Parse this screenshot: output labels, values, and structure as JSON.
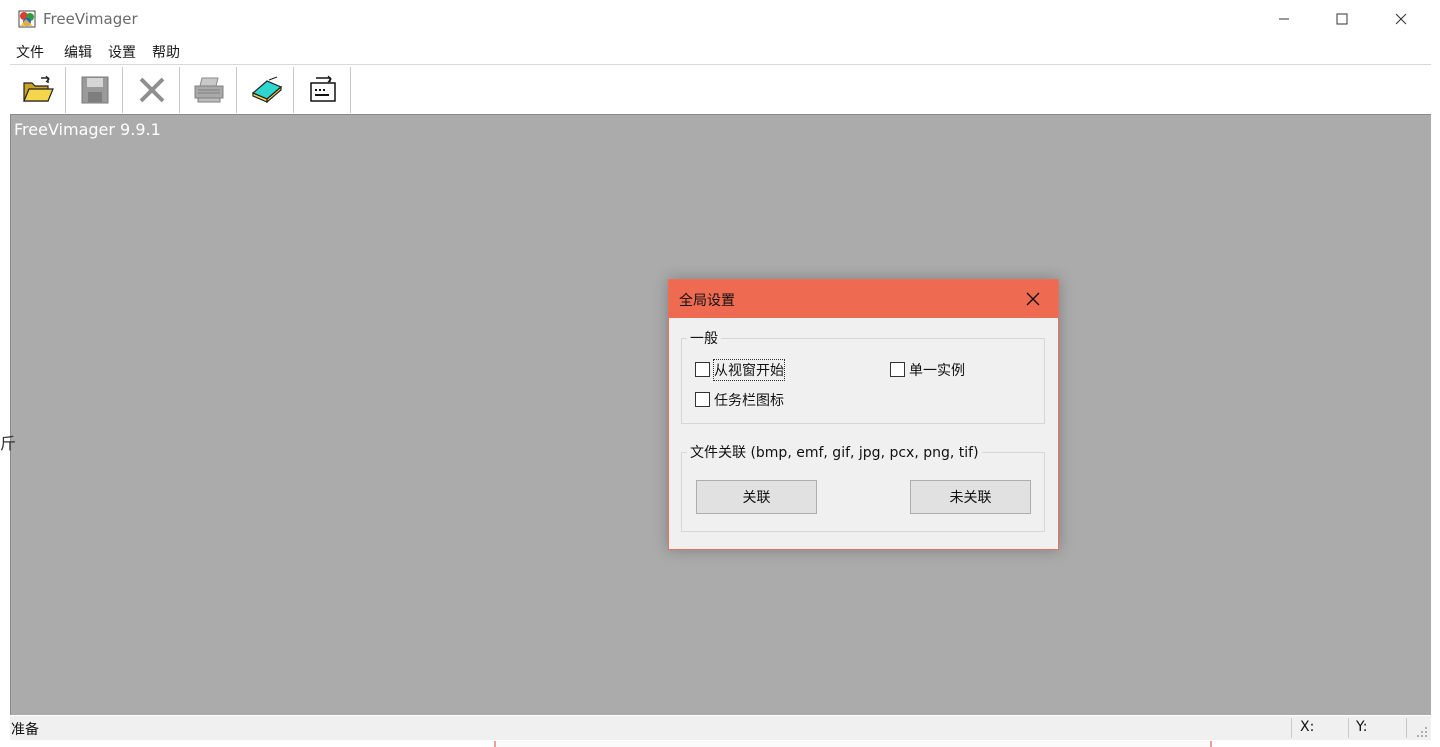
{
  "window": {
    "title": "FreeVimager",
    "controls": {
      "minimize": "—",
      "maximize": "☐",
      "close": "✕"
    }
  },
  "menubar": {
    "items": [
      {
        "label": "文件"
      },
      {
        "label": "编辑"
      },
      {
        "label": "设置"
      },
      {
        "label": "帮助"
      }
    ]
  },
  "toolbar": {
    "buttons": [
      {
        "icon": "open-folder-icon"
      },
      {
        "icon": "save-disk-icon"
      },
      {
        "icon": "close-x-icon"
      },
      {
        "icon": "printer-icon"
      },
      {
        "icon": "scanner-icon"
      },
      {
        "icon": "slideshow-icon"
      }
    ]
  },
  "workspace": {
    "version_label": "FreeVimager 9.9.1",
    "background_color": "#ababab"
  },
  "statusbar": {
    "text": "准备",
    "x_label": "X:",
    "y_label": "Y:"
  },
  "background_window": {
    "edge_text": "斤"
  },
  "dialog": {
    "title": "全局设置",
    "title_color": "#ee6a51",
    "general_group": {
      "legend": "一般",
      "checkboxes": [
        {
          "label": "从视窗开始",
          "checked": false,
          "focused": true
        },
        {
          "label": "单一实例",
          "checked": false
        },
        {
          "label": "任务栏图标",
          "checked": false
        }
      ]
    },
    "association_group": {
      "legend": "文件关联 (bmp, emf, gif, jpg, pcx, png, tif)",
      "associate_button": "关联",
      "unassociate_button": "未关联"
    }
  }
}
